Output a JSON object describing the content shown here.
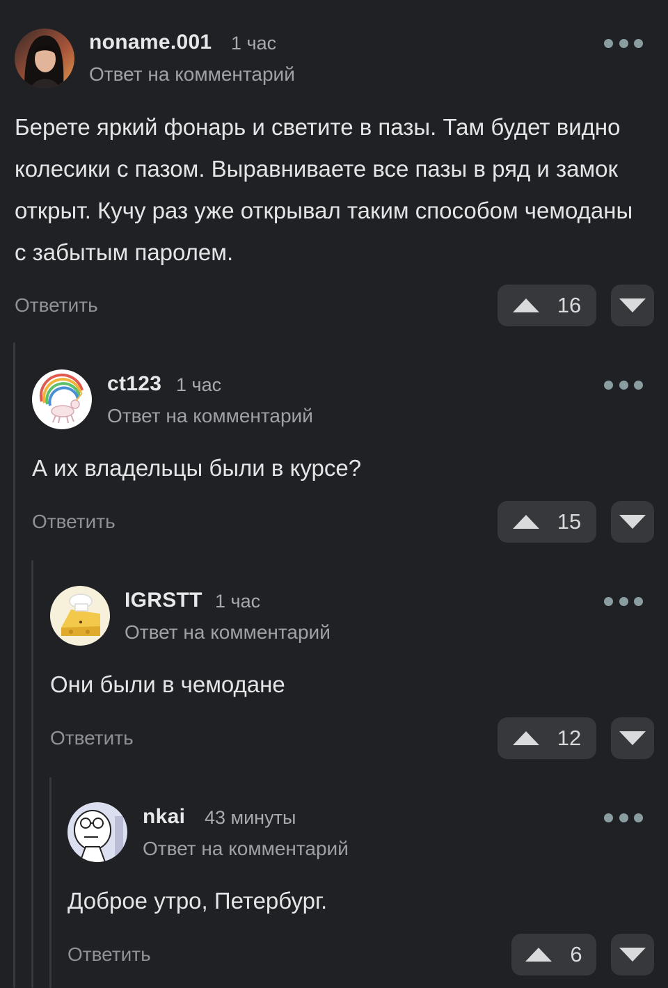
{
  "common": {
    "reply_label": "Ответить",
    "reply_to_label": "Ответ на комментарий"
  },
  "comments": [
    {
      "author": "noname.001",
      "time": "1 час",
      "text": "Берете яркий фонарь и светите в пазы. Там будет видно колесики с пазом. Выравниваете все пазы в ряд и замок открыт. Кучу раз уже открывал таким способом чемоданы с забытым паролем.",
      "upvotes": "16",
      "avatar_icon": "woman-portrait-avatar"
    },
    {
      "author": "ct123",
      "time": "1 час",
      "text": "А их владельцы были в курсе?",
      "upvotes": "15",
      "avatar_icon": "rainbow-unicorn-avatar"
    },
    {
      "author": "IGRSTT",
      "time": "1 час",
      "text": "Они были в чемодане",
      "upvotes": "12",
      "avatar_icon": "cheese-chef-avatar"
    },
    {
      "author": "nkai",
      "time": "43 минуты",
      "text": "Доброе утро, Петербург.",
      "upvotes": "6",
      "avatar_icon": "meme-face-avatar"
    }
  ],
  "colors": {
    "background": "#202124",
    "button_bg": "#36383b",
    "dots": "#8a9da0"
  }
}
